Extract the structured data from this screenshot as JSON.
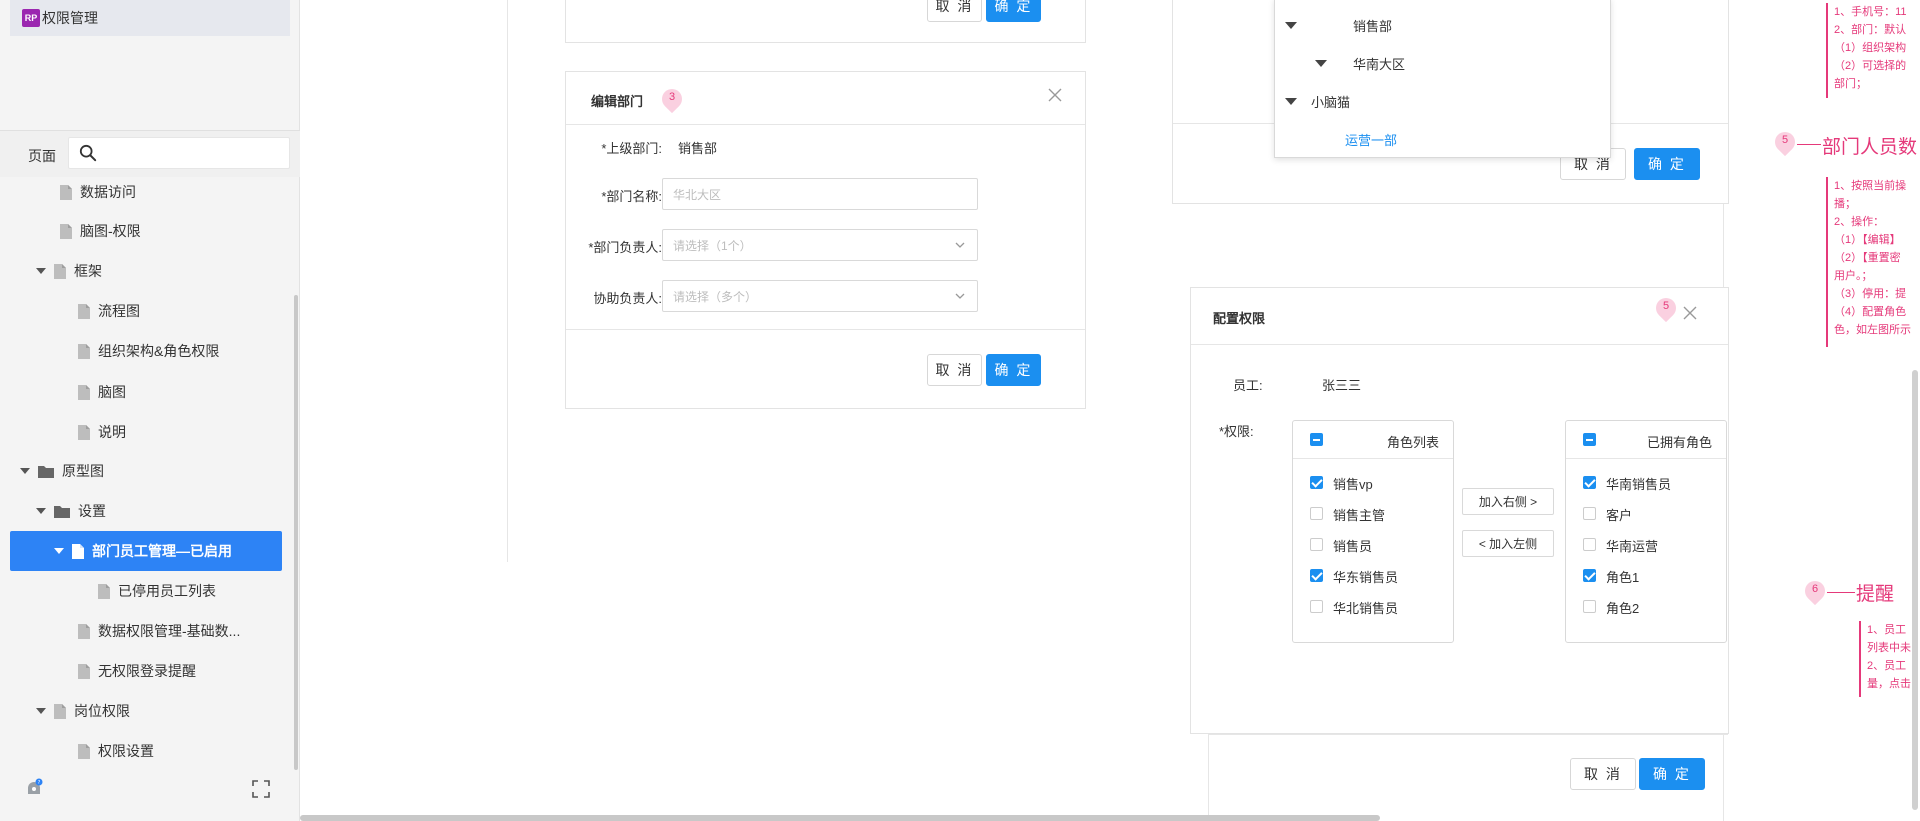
{
  "sidebar": {
    "project_badge": "RP",
    "project_name": "权限管理",
    "pages_label": "页面",
    "search_placeholder": "",
    "tree": [
      {
        "label": "数据访问",
        "type": "page"
      },
      {
        "label": "脑图-权限",
        "type": "page"
      },
      {
        "label": "框架",
        "type": "page",
        "expanded": true
      },
      {
        "label": "流程图",
        "type": "page"
      },
      {
        "label": "组织架构&角色权限",
        "type": "page"
      },
      {
        "label": "脑图",
        "type": "page"
      },
      {
        "label": "说明",
        "type": "page"
      },
      {
        "label": "原型图",
        "type": "folder",
        "expanded": true
      },
      {
        "label": "设置",
        "type": "folder",
        "expanded": true
      },
      {
        "label": "部门员工管理—已启用",
        "type": "page",
        "expanded": true,
        "selected": true
      },
      {
        "label": "已停用员工列表",
        "type": "page"
      },
      {
        "label": "数据权限管理-基础数...",
        "type": "page"
      },
      {
        "label": "无权限登录提醒",
        "type": "page"
      },
      {
        "label": "岗位权限",
        "type": "page",
        "expanded": true
      },
      {
        "label": "权限设置",
        "type": "page"
      }
    ]
  },
  "top_modal": {
    "cancel": "取 消",
    "ok": "确 定"
  },
  "edit_dept": {
    "title": "编辑部门",
    "marker": "3",
    "parent_label": "*上级部门:",
    "parent_value": "销售部",
    "name_label": "*部门名称:",
    "name_placeholder": "华北大区",
    "leader_label": "*部门负责人:",
    "leader_placeholder": "请选择（1个）",
    "assist_label": "协助负责人:",
    "assist_placeholder": "请选择（多个）",
    "cancel": "取 消",
    "ok": "确 定"
  },
  "dept_tree_dropdown": {
    "items": [
      {
        "label": "销售部",
        "level": 1,
        "caret": true
      },
      {
        "label": "华南大区",
        "level": 2,
        "caret": true
      },
      {
        "label": "小脑猫",
        "level": 0,
        "caret": true
      },
      {
        "label": "运营一部",
        "level": 2,
        "caret": false,
        "highlight": true
      }
    ],
    "cancel": "取 消",
    "ok": "确 定"
  },
  "perm_modal": {
    "title": "配置权限",
    "marker": "5",
    "employee_label": "员工:",
    "employee_value": "张三三",
    "perm_label": "*权限:",
    "left_title": "角色列表",
    "left_items": [
      {
        "label": "销售vp",
        "checked": true
      },
      {
        "label": "销售主管",
        "checked": false
      },
      {
        "label": "销售员",
        "checked": false
      },
      {
        "label": "华东销售员",
        "checked": true
      },
      {
        "label": "华北销售员",
        "checked": false
      }
    ],
    "right_title": "已拥有角色",
    "right_items": [
      {
        "label": "华南销售员",
        "checked": true
      },
      {
        "label": "客户",
        "checked": false
      },
      {
        "label": "华南运营",
        "checked": false
      },
      {
        "label": "角色1",
        "checked": true
      },
      {
        "label": "角色2",
        "checked": false
      }
    ],
    "to_right": "加入右侧 >",
    "to_left": "< 加入左侧",
    "cancel": "取 消",
    "ok": "确 定"
  },
  "annotations": {
    "top_box": [
      "1、手机号：11",
      "2、部门：默认",
      "（1）组织架构",
      "（2）可选择的",
      "部门；"
    ],
    "head5_num": "5",
    "head5_text": "部门人员数",
    "box5": [
      "1、按照当前操",
      "播；",
      "2、操作：",
      "（1）【编辑】",
      "（2）【重置密",
      "用户。；",
      "（3）停用：提",
      "（4）配置角色",
      "色，如左图所示"
    ],
    "head6_num": "6",
    "head6_text": "提醒",
    "box6": [
      "1、员工",
      "列表中未",
      "2、员工",
      "量，点击"
    ]
  },
  "colors": {
    "accent": "#1b8ff0",
    "selected_tree": "#2d83f5",
    "annotation": "#e5397a",
    "badge": "#9b27b0"
  }
}
